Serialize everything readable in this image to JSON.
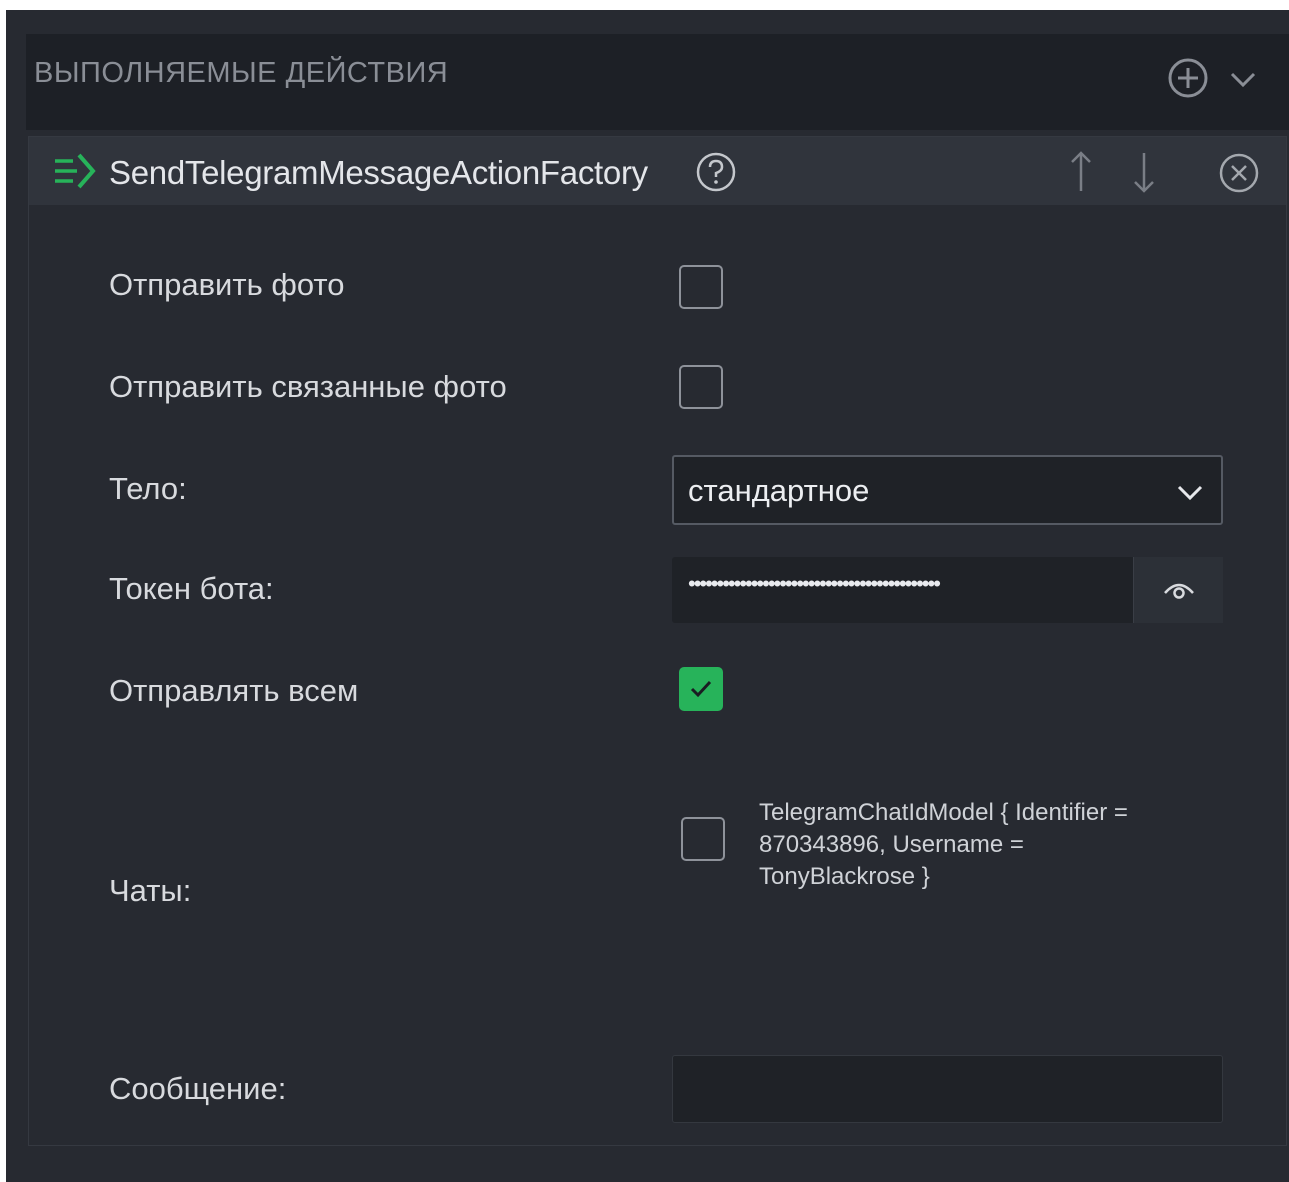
{
  "section": {
    "title": "ВЫПОЛНЯЕМЫЕ ДЕЙСТВИЯ",
    "add_icon": "plus-circle-icon",
    "collapse_icon": "chevron-down-icon"
  },
  "action": {
    "title": "SendTelegramMessageActionFactory",
    "icon": "arrow-right-lines-icon",
    "help_icon": "question-circle-icon",
    "move_up_icon": "arrow-up-icon",
    "move_down_icon": "arrow-down-icon",
    "remove_icon": "close-circle-icon"
  },
  "form": {
    "send_photo": {
      "label": "Отправить фото",
      "checked": false
    },
    "send_related_photo": {
      "label": "Отправить связанные фото",
      "checked": false
    },
    "body": {
      "label": "Тело:",
      "value": "стандартное"
    },
    "bot_token": {
      "label": "Токен бота:",
      "masked_value": "••••••••••••••••••••••••••••••••••••••••••••",
      "reveal_icon": "eye-icon"
    },
    "send_to_all": {
      "label": "Отправлять всем",
      "checked": true
    },
    "chats": {
      "label": "Чаты:",
      "options": [
        {
          "text": "TelegramChatIdModel { Identifier = 870343896, Username = TonyBlackrose }",
          "checked": false
        }
      ]
    },
    "message": {
      "label": "Сообщение:",
      "value": ""
    }
  },
  "colors": {
    "background": "#272a31",
    "header": "#1d2026",
    "accent_green": "#27b35a",
    "text": "#d8dade",
    "muted": "#8a8e96"
  }
}
